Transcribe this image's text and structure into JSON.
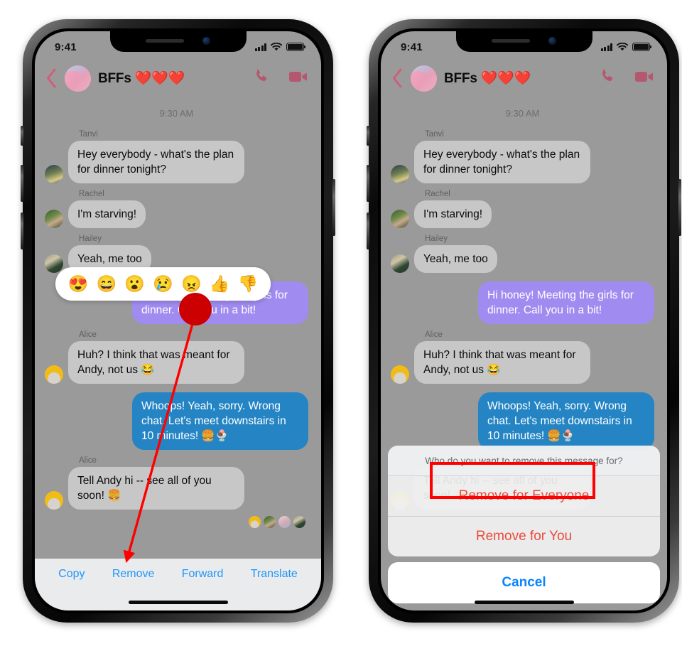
{
  "status_bar": {
    "time": "9:41"
  },
  "chat_header": {
    "title": "BFFs ❤️❤️❤️",
    "back_icon": "back-chevron-icon",
    "call_icon": "phone-call-icon",
    "video_icon": "video-call-icon",
    "avatar_icon": "group-avatar"
  },
  "conversation": {
    "daystamp": "9:30 AM",
    "messages": [
      {
        "sender": "Tanvi",
        "text": "Hey everybody - what's the plan for dinner tonight?",
        "side": "in"
      },
      {
        "sender": "Rachel",
        "text": "I'm starving!",
        "side": "in"
      },
      {
        "sender": "Hailey",
        "text": "Yeah, me too",
        "side": "in"
      },
      {
        "sender": "",
        "text": "Hi honey! Meeting the girls for dinner. Call you in a bit!",
        "side": "out",
        "color": "purple"
      },
      {
        "sender": "Alice",
        "text": "Huh? I think that was meant for Andy, not us 😂",
        "side": "in"
      },
      {
        "sender": "",
        "text": "Whoops! Yeah, sorry. Wrong chat. Let's meet downstairs in 10 minutes! 🍔🍨",
        "side": "out",
        "color": "blue"
      },
      {
        "sender": "Alice",
        "text": "Tell Andy hi -- see all of you soon! 🍔",
        "side": "in"
      }
    ],
    "read_receipts_count": 4
  },
  "reaction_bar": {
    "emojis": [
      "😍",
      "😄",
      "😮",
      "😢",
      "😠",
      "👍",
      "👎"
    ],
    "names": [
      "love-reaction",
      "haha-reaction",
      "wow-reaction",
      "sad-reaction",
      "angry-reaction",
      "like-reaction",
      "dislike-reaction"
    ]
  },
  "action_bar": {
    "items": [
      {
        "label": "Copy",
        "name": "copy-button"
      },
      {
        "label": "Remove",
        "name": "remove-button"
      },
      {
        "label": "Forward",
        "name": "forward-button"
      },
      {
        "label": "Translate",
        "name": "translate-button"
      }
    ]
  },
  "action_sheet": {
    "title": "Who do you want to remove this message for?",
    "remove_everyone": "Remove for Everyone",
    "remove_you": "Remove for You",
    "cancel": "Cancel"
  },
  "annotations": {
    "highlight_color": "#fe0000",
    "pointer_dot_color": "#cc0000",
    "arrow_color": "#fe0000",
    "dot_label": "tap-target-dot",
    "arrow_label": "pointer-arrow",
    "box_label": "highlight-box-remove-for-everyone"
  },
  "colors": {
    "screen_bg": "#9a9a9a",
    "bubble_in": "#e4e4e4",
    "bubble_purple": "#a08cf0",
    "bubble_blue": "#2585c4",
    "action_link": "#2196fb",
    "sheet_destructive": "#eb4b3c",
    "sheet_cancel": "#0a84ff",
    "header_icon": "#b5576f"
  }
}
